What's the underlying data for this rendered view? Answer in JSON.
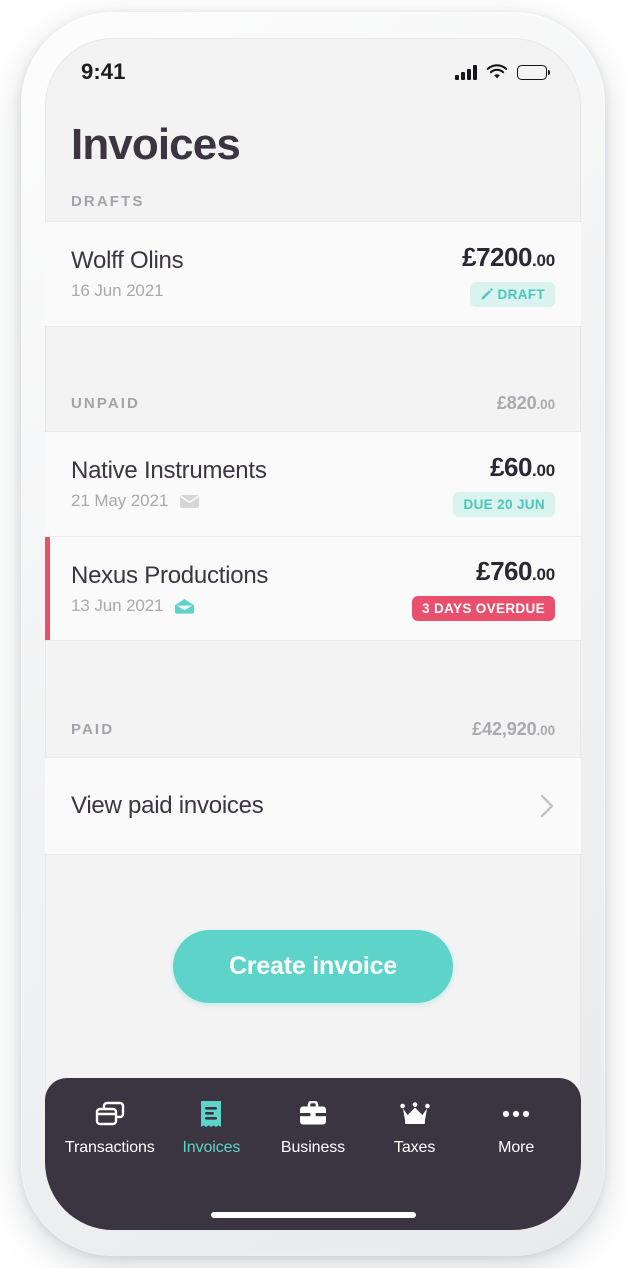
{
  "status_bar": {
    "time": "9:41",
    "signal_icon": "cellular-signal-icon",
    "wifi_icon": "wifi-icon",
    "battery_icon": "battery-full-icon"
  },
  "header": {
    "title": "Invoices"
  },
  "sections": [
    {
      "label": "DRAFTS",
      "total": "",
      "total_cents": "",
      "rows": [
        {
          "client": "Wolff Olins",
          "date": "16 Jun 2021",
          "amount": "£7200",
          "cents": ".00",
          "badge": "DRAFT",
          "badge_style": "mint",
          "badge_icon": "pencil-icon",
          "envelope_icon": "",
          "overdue": false
        }
      ]
    },
    {
      "label": "UNPAID",
      "total": "£820",
      "total_cents": ".00",
      "rows": [
        {
          "client": "Native Instruments",
          "date": "21 May 2021",
          "amount": "£60",
          "cents": ".00",
          "badge": "DUE 20 JUN",
          "badge_style": "mint",
          "badge_icon": "",
          "envelope_icon": "envelope-closed-icon",
          "overdue": false
        },
        {
          "client": "Nexus Productions",
          "date": "13 Jun 2021",
          "amount": "£760",
          "cents": ".00",
          "badge": "3 DAYS OVERDUE",
          "badge_style": "rose",
          "badge_icon": "",
          "envelope_icon": "envelope-open-icon",
          "overdue": true
        }
      ]
    },
    {
      "label": "PAID",
      "total": "£42,920",
      "total_cents": ".00",
      "rows": []
    }
  ],
  "paid_link": {
    "label": "View paid invoices",
    "chevron_icon": "chevron-right-icon"
  },
  "cta": {
    "label": "Create invoice"
  },
  "tab_bar": {
    "items": [
      {
        "label": "Transactions",
        "icon": "cards-icon",
        "active": false
      },
      {
        "label": "Invoices",
        "icon": "receipt-icon",
        "active": true
      },
      {
        "label": "Business",
        "icon": "briefcase-icon",
        "active": false
      },
      {
        "label": "Taxes",
        "icon": "crown-icon",
        "active": false
      },
      {
        "label": "More",
        "icon": "ellipsis-icon",
        "active": false
      }
    ],
    "home_indicator": "home-indicator"
  },
  "colors": {
    "accent_teal": "#5ed3ca",
    "badge_mint_bg": "#d9f3ef",
    "badge_mint_text": "#4cc6bb",
    "overdue_rose": "#e8506e",
    "tab_bar_dark": "#3b3542",
    "text_primary": "#3b3542",
    "text_muted": "#a9a9ae",
    "screen_bg": "#f3f3f4",
    "row_bg": "#fafafa"
  }
}
